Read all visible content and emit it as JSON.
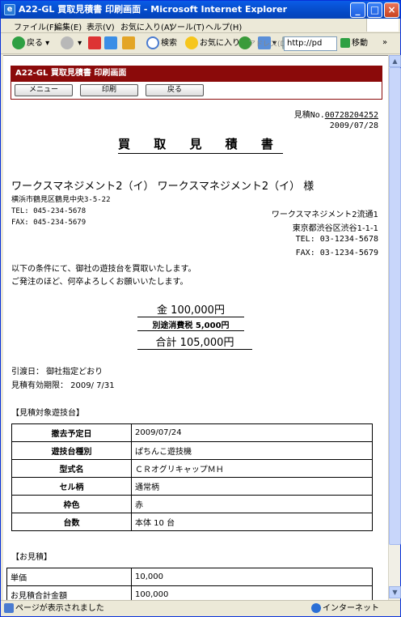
{
  "window": {
    "title": "A22-GL 買取見積書 印刷画面 - Microsoft Internet Explorer",
    "min": "_",
    "max": "□",
    "close": "×"
  },
  "menu": [
    "ファイル(F)",
    "編集(E)",
    "表示(V)",
    "お気に入り(A)",
    "ツール(T)",
    "ヘルプ(H)"
  ],
  "toolbar": {
    "back": "戻る",
    "search": "検索",
    "favorites": "お気に入り",
    "address_label": "アドレス(D)",
    "address": "http://pd",
    "go": "移動",
    "links": "»"
  },
  "page": {
    "header": "A22-GL 買取見積書 印刷画面",
    "buttons": {
      "menu": "メニュー",
      "print": "印刷",
      "back": "戻る"
    },
    "estimate_no_label": "見積No.",
    "estimate_no": "00728204252",
    "date": "2009/07/28",
    "doc_title": "買 取 見 積 書",
    "customer": "ワークスマネジメント2（イ） ワークスマネジメント2（イ） 様",
    "cust_addr": "横浜市鶴見区鶴見中央3-5-22",
    "cust_tel": "TEL: 045-234-5678",
    "cust_fax": "FAX: 045-234-5679",
    "company": "ワークスマネジメント2流通1",
    "comp_addr": "東京都渋谷区渋谷1-1-1",
    "comp_tel": "TEL: 03-1234-5678",
    "comp_fax": "FAX: 03-1234-5679",
    "intro1": "以下の条件にて、御社の遊技台を買取いたします。",
    "intro2": "ご発注のほど、何卒よろしくお願いいたします。",
    "amount": "金 100,000円",
    "tax": "別途消費税 5,000円",
    "total": "合計 105,000円",
    "delivery": "引渡日： 御社指定どおり",
    "validity": "見積有効期限： 2009/ 7/31",
    "section1": "【見積対象遊技台】",
    "items": [
      {
        "k": "撤去予定日",
        "v": "2009/07/24"
      },
      {
        "k": "遊技台種別",
        "v": "ぱちんこ遊技機"
      },
      {
        "k": "型式名",
        "v": "ＣＲオグリキャップＭＨ"
      },
      {
        "k": "セル柄",
        "v": "通常柄"
      },
      {
        "k": "枠色",
        "v": "赤"
      },
      {
        "k": "台数",
        "v": "本体 10 台"
      }
    ],
    "section2": "【お見積】",
    "quote": [
      {
        "k": "単価",
        "v": "10,000"
      },
      {
        "k": "お見積合計金額",
        "v": "100,000"
      }
    ]
  },
  "status": {
    "left": "ページが表示されました",
    "zone": "インターネット"
  }
}
